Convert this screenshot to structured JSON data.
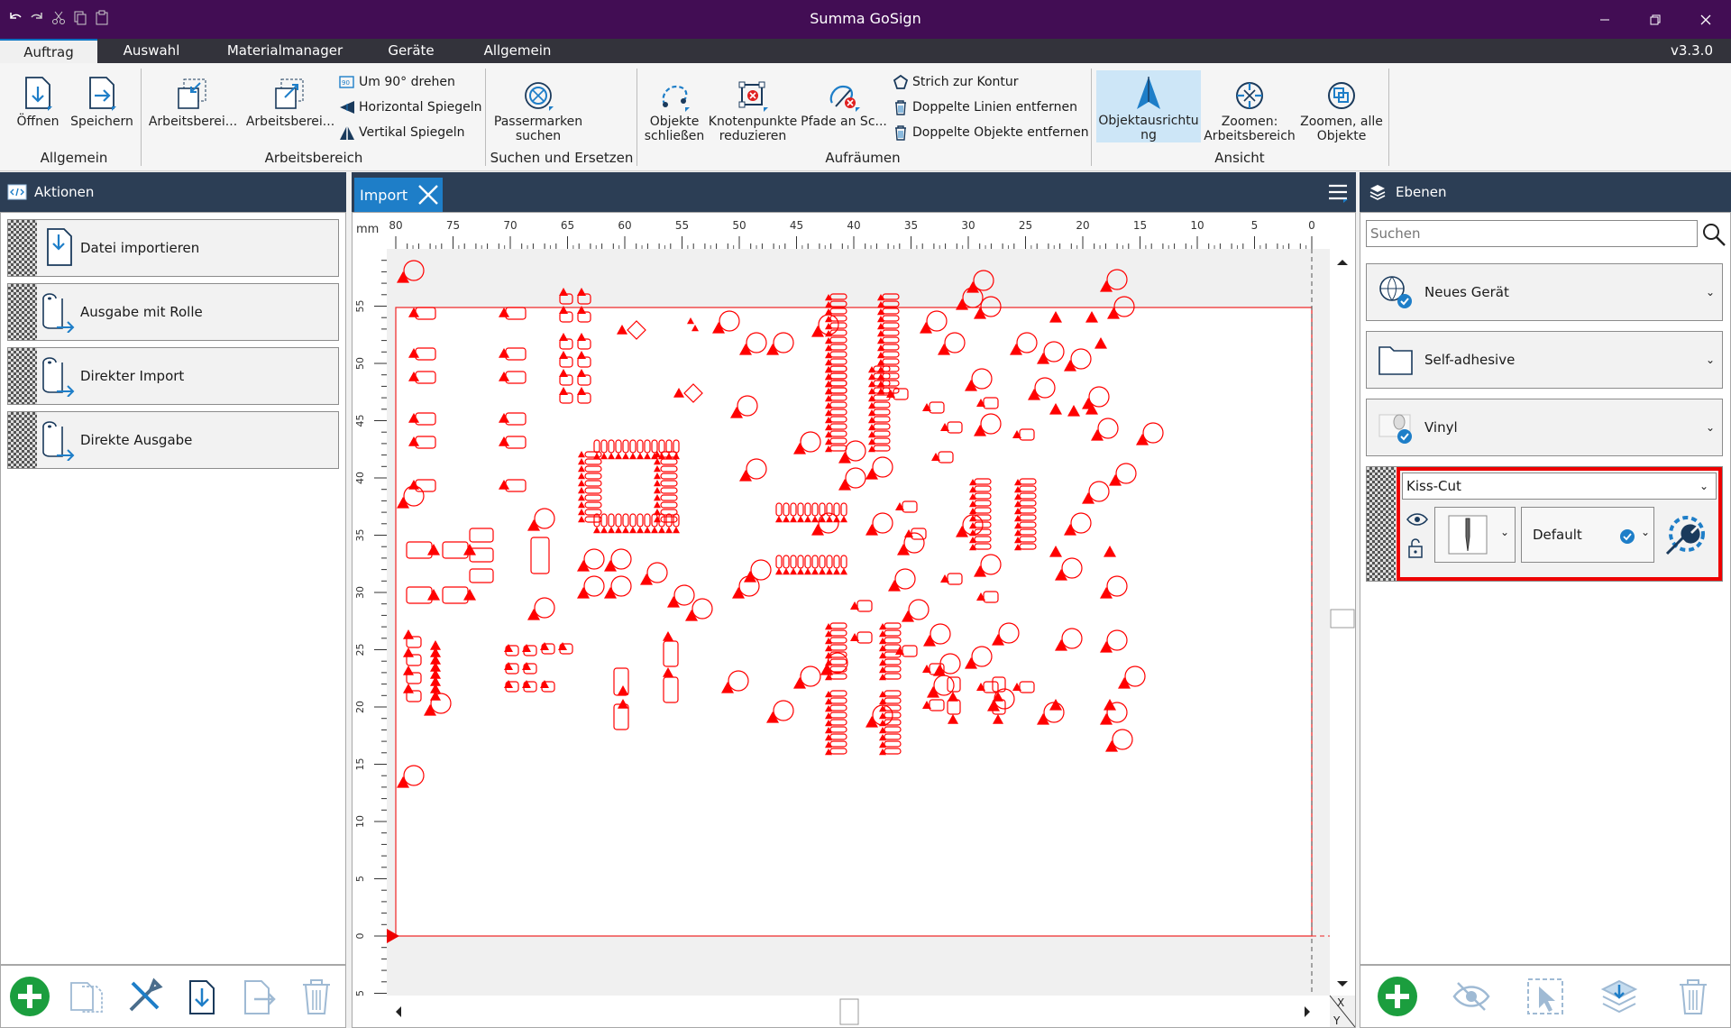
{
  "app": {
    "title": "Summa GoSign",
    "version": "v3.3.0"
  },
  "colors": {
    "titlebar": "#420d54",
    "menubar": "#33333b",
    "panel_header": "#2c3e55",
    "accent": "#1e7ec8",
    "cut_red": "#ff0000",
    "add_green": "#1b9e3e"
  },
  "menu": {
    "tabs": [
      "Auftrag",
      "Auswahl",
      "Materialmanager",
      "Geräte",
      "Allgemein"
    ],
    "active": "Auftrag"
  },
  "ribbon": {
    "allgemein": {
      "label": "Allgemein",
      "open": "Öffnen",
      "save": "Speichern"
    },
    "arbeitsbereich": {
      "label": "Arbeitsbereich",
      "btn1": "Arbeitsberei...",
      "btn2": "Arbeitsberei...",
      "rotate": "Um 90° drehen",
      "mirror_h": "Horizontal Spiegeln",
      "mirror_v": "Vertikal Spiegeln"
    },
    "suchen": {
      "label": "Suchen und Ersetzen",
      "btn_line1": "Passermarken",
      "btn_line2": "suchen"
    },
    "aufraeumen": {
      "label": "Aufräumen",
      "close_line1": "Objekte",
      "close_line2": "schließen",
      "reduce_line1": "Knotenpunkte",
      "reduce_line2": "reduzieren",
      "paths": "Pfade an Sc...",
      "stroke": "Strich zur Kontur",
      "dup_lines": "Doppelte Linien entfernen",
      "dup_objects": "Doppelte Objekte entfernen"
    },
    "ansicht": {
      "label": "Ansicht",
      "orient_line1": "Objektausrichtu",
      "orient_line2": "ng",
      "zoom_ws_line1": "Zoomen:",
      "zoom_ws_line2": "Arbeitsbereich",
      "zoom_all_line1": "Zoomen, alle",
      "zoom_all_line2": "Objekte"
    }
  },
  "actions": {
    "title": "Aktionen",
    "items": [
      "Datei importieren",
      "Ausgabe mit Rolle",
      "Direkter Import",
      "Direkte Ausgabe"
    ]
  },
  "document": {
    "tab": "Import",
    "ruler_unit": "mm",
    "top_ticks": [
      "80",
      "75",
      "70",
      "65",
      "60",
      "55",
      "50",
      "45",
      "40",
      "35",
      "30",
      "25",
      "20",
      "15",
      "10",
      "5",
      "0"
    ],
    "left_ticks": [
      "55",
      "50",
      "45",
      "40",
      "35",
      "30",
      "25",
      "20",
      "15",
      "10",
      "5",
      "0",
      "5"
    ],
    "corner_x": "X",
    "corner_y": "Y"
  },
  "layers": {
    "title": "Ebenen",
    "search_placeholder": "Suchen",
    "device": "Neues Gerät",
    "material_type": "Self-adhesive",
    "material": "Vinyl",
    "cut_layer": "Kiss-Cut",
    "tool_preset": "Default"
  }
}
